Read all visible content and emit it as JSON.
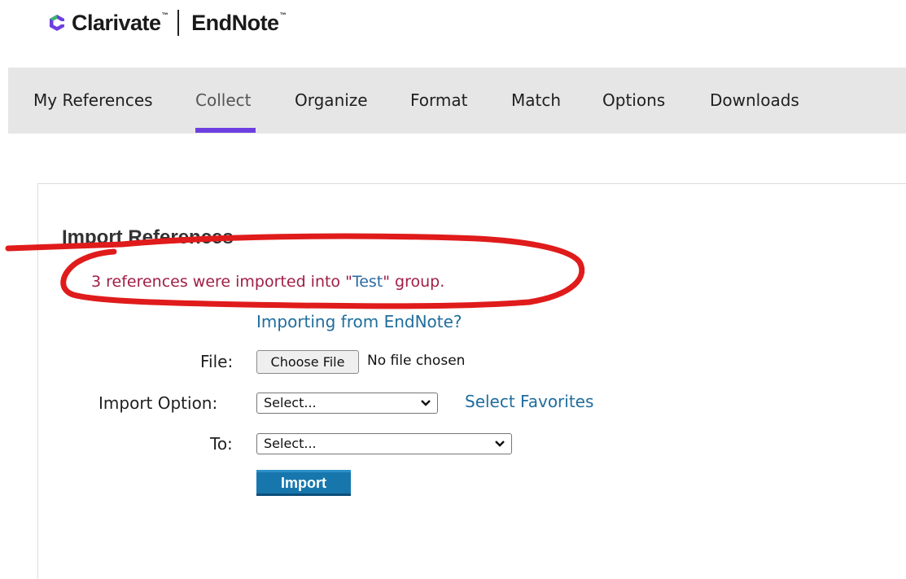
{
  "header": {
    "brand_primary": "Clarivate",
    "brand_primary_tm": "™",
    "brand_secondary": "EndNote",
    "brand_secondary_tm": "™",
    "logo_icon": "clarivate-logo-icon"
  },
  "nav": {
    "active": "Collect",
    "accent_color": "#6d3fe0",
    "tabs": [
      {
        "label": "My References"
      },
      {
        "label": "Collect"
      },
      {
        "label": "Organize"
      },
      {
        "label": "Format"
      },
      {
        "label": "Match"
      },
      {
        "label": "Options"
      },
      {
        "label": "Downloads"
      }
    ]
  },
  "main": {
    "section_title": "Import References",
    "status": {
      "prefix": "3 references were imported into \"",
      "group": "Test",
      "suffix": "\" group."
    },
    "importing_link": "Importing from EndNote?",
    "file_label": "File:",
    "choose_file_label": "Choose File",
    "no_file_text": "No file chosen",
    "import_option_label": "Import Option:",
    "import_option_value": "Select...",
    "select_favorites_link": "Select Favorites",
    "to_label": "To:",
    "to_value": "Select...",
    "import_button": "Import"
  },
  "annotation": {
    "color": "#e01b1b",
    "shape": "hand-drawn-circle"
  }
}
